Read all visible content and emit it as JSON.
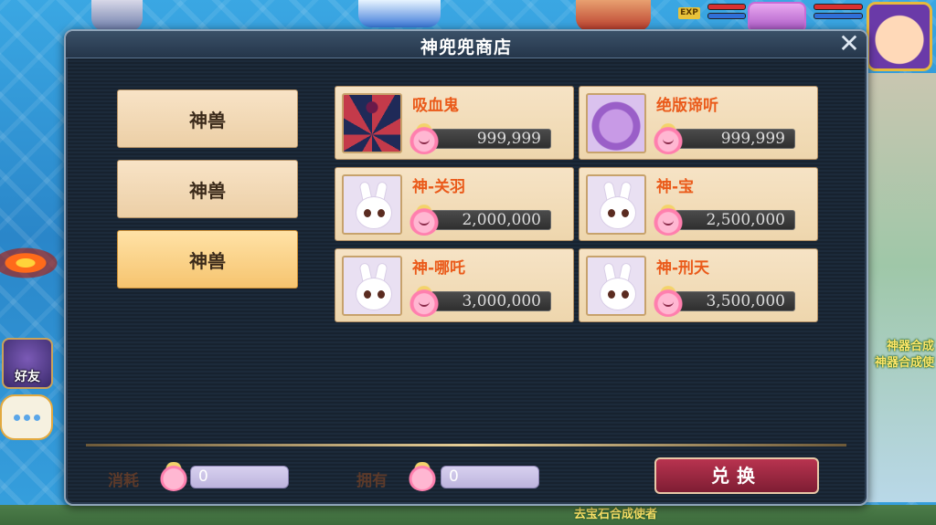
{
  "shop": {
    "title": "神兜兜商店",
    "close_glyph": "✕",
    "categories": [
      {
        "label": "神兽",
        "active": false
      },
      {
        "label": "神兽",
        "active": false
      },
      {
        "label": "神兽",
        "active": true
      }
    ],
    "items": [
      {
        "name": "吸血鬼",
        "price": "999,999",
        "icon": "vampire-pet-icon"
      },
      {
        "name": "绝版谛听",
        "price": "999,999",
        "icon": "diting-pet-icon"
      },
      {
        "name": "神-关羽",
        "price": "2,000,000",
        "icon": "rabbit-pet-icon"
      },
      {
        "name": "神-宝",
        "price": "2,500,000",
        "icon": "rabbit-pet-icon"
      },
      {
        "name": "神-哪吒",
        "price": "3,000,000",
        "icon": "rabbit-pet-icon"
      },
      {
        "name": "神-刑天",
        "price": "3,500,000",
        "icon": "rabbit-pet-icon"
      }
    ],
    "footer": {
      "cost_label": "消耗",
      "cost_value": "0",
      "owned_label": "拥有",
      "owned_value": "0",
      "exchange_label": "兑换"
    }
  },
  "hud": {
    "exp_badge": "EXP",
    "friend_label": "好友",
    "npc_labels": [
      "神器合成",
      "神器合成使"
    ],
    "bottom_label": "去宝石合成使者"
  },
  "colors": {
    "item_name": "#ea5a1a",
    "button_active": "#f6c46f",
    "exchange_button": "#9c2540"
  }
}
